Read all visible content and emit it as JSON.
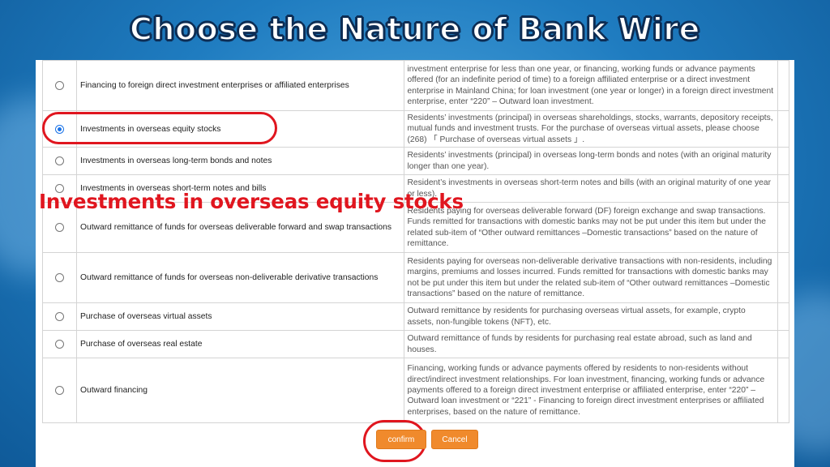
{
  "header": {
    "title": "Choose the Nature of Bank Wire"
  },
  "overlay": {
    "caption": "Investments in overseas equity stocks"
  },
  "colors": {
    "accent_red": "#e0161f",
    "button_orange": "#f08a2c",
    "radio_blue": "#1a73e8"
  },
  "rows": [
    {
      "selected": false,
      "name": "Financing to foreign direct investment enterprises or affiliated enterprises",
      "description": "investment enterprise for less than one year, or financing, working funds or advance payments offered (for an indefinite period of time) to a foreign affiliated enterprise or a direct investment enterprise in Mainland China; for loan investment (one year or longer) in a foreign direct investment enterprise, enter “220” – Outward loan investment."
    },
    {
      "selected": true,
      "name": "Investments in overseas equity stocks",
      "description": "Residents’ investments (principal) in overseas shareholdings, stocks, warrants, depository receipts, mutual funds and investment trusts. For the purchase of overseas virtual assets, please choose (268) 「 Purchase of overseas virtual assets 」."
    },
    {
      "selected": false,
      "name": "Investments in overseas long-term bonds and notes",
      "description": "Residents’ investments (principal) in overseas long-term bonds and notes (with an original maturity longer than one year)."
    },
    {
      "selected": false,
      "name": "Investments in overseas short-term notes and bills",
      "description": "Resident’s investments in overseas short-term notes and bills (with an original maturity of one year or less)."
    },
    {
      "selected": false,
      "name": "Outward remittance of funds for overseas deliverable forward and swap transactions",
      "description": "Residents paying for overseas deliverable forward (DF) foreign exchange and swap transactions. Funds remitted for transactions with domestic banks may not be put under this item but under the related sub-item of “Other outward remittances –Domestic transactions” based on the nature of remittance."
    },
    {
      "selected": false,
      "name": "Outward remittance of funds for overseas non-deliverable derivative transactions",
      "description": "Residents paying for overseas non-deliverable derivative transactions with non-residents, including margins, premiums and losses incurred. Funds remitted for transactions with domestic banks may not be put under this item but under the related sub-item of “Other outward remittances –Domestic transactions” based on the nature of remittance."
    },
    {
      "selected": false,
      "name": "Purchase of overseas virtual assets",
      "description": "Outward remittance by residents for purchasing overseas virtual assets, for example, crypto assets, non-fungible tokens (NFT), etc."
    },
    {
      "selected": false,
      "name": "Purchase of overseas real estate",
      "description": "Outward remittance of funds by residents for purchasing real estate abroad, such as land and houses."
    },
    {
      "selected": false,
      "name": "Outward financing",
      "description": "Financing, working funds or advance payments offered by residents to non-residents without direct/indirect investment relationships. For loan investment, financing, working funds or advance payments offered to a foreign direct investment enterprise or affiliated enterprise, enter “220” – Outward loan investment or “221” - Financing to foreign direct investment enterprises or affiliated enterprises, based on the nature of remittance."
    }
  ],
  "buttons": {
    "confirm": "confirm",
    "cancel": "Cancel"
  }
}
